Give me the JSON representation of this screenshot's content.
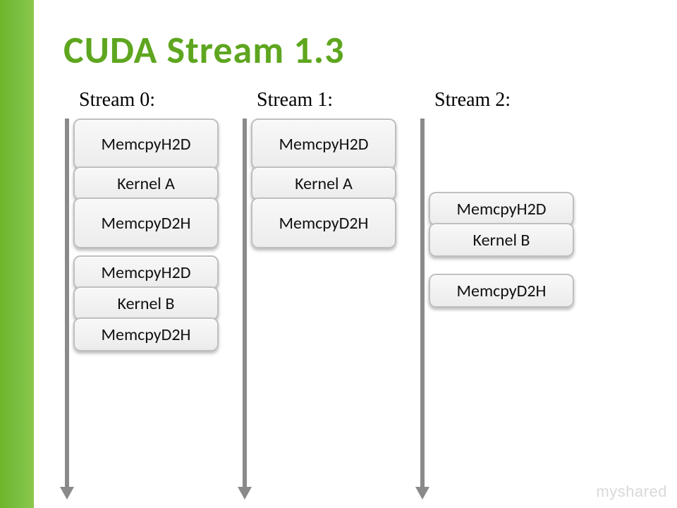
{
  "title": "CUDA Stream 1.3",
  "watermark": "myshared",
  "streams": [
    {
      "label": "Stream 0:",
      "groups": [
        {
          "ops": [
            "MemcpyH2D",
            "Kernel A",
            "MemcpyD2H"
          ]
        },
        {
          "ops": [
            "MemcpyH2D",
            "Kernel B",
            "MemcpyD2H"
          ]
        }
      ]
    },
    {
      "label": "Stream 1:",
      "groups": [
        {
          "ops": [
            "MemcpyH2D",
            "Kernel A",
            "MemcpyD2H"
          ]
        }
      ]
    },
    {
      "label": "Stream 2:",
      "groups": [
        {
          "ops": [
            "MemcpyH2D",
            "Kernel B"
          ]
        },
        {
          "ops": [
            "MemcpyD2H"
          ]
        }
      ]
    }
  ]
}
